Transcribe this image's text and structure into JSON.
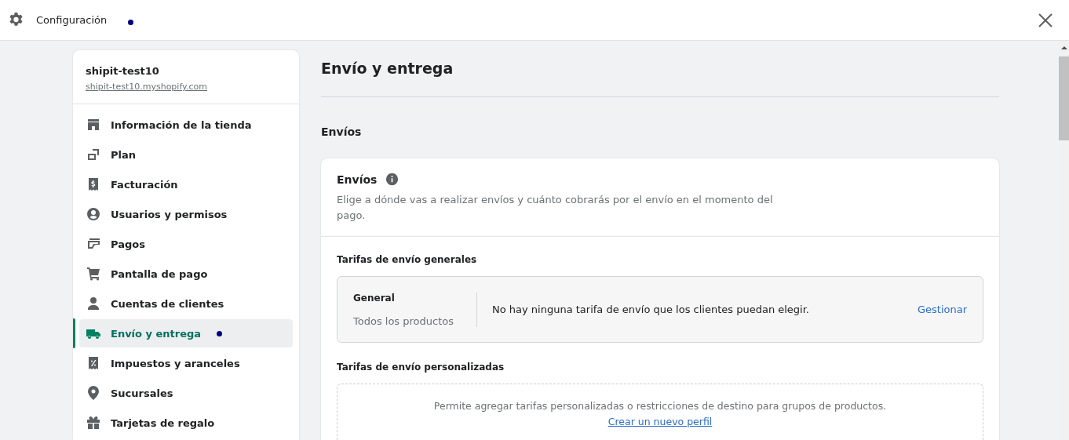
{
  "header": {
    "title": "Configuración",
    "marked": true
  },
  "store": {
    "name": "shipit-test10",
    "url": "shipit-test10.myshopify.com"
  },
  "nav": [
    {
      "label": "Información de la tienda",
      "selected": false,
      "marked": false
    },
    {
      "label": "Plan",
      "selected": false,
      "marked": false
    },
    {
      "label": "Facturación",
      "selected": false,
      "marked": false
    },
    {
      "label": "Usuarios y permisos",
      "selected": false,
      "marked": false
    },
    {
      "label": "Pagos",
      "selected": false,
      "marked": false
    },
    {
      "label": "Pantalla de pago",
      "selected": false,
      "marked": false
    },
    {
      "label": "Cuentas de clientes",
      "selected": false,
      "marked": false
    },
    {
      "label": "Envío y entrega",
      "selected": true,
      "marked": true
    },
    {
      "label": "Impuestos y aranceles",
      "selected": false,
      "marked": false
    },
    {
      "label": "Sucursales",
      "selected": false,
      "marked": false
    },
    {
      "label": "Tarjetas de regalo",
      "selected": false,
      "marked": false
    }
  ],
  "page": {
    "title": "Envío y entrega",
    "section": "Envíos"
  },
  "card": {
    "title": "Envíos",
    "description": "Elige a dónde vas a realizar envíos y cuánto cobrarás por el envío en el momento del pago.",
    "general": {
      "heading": "Tarifas de envío generales",
      "name": "General",
      "scope": "Todos los productos",
      "message": "No hay ninguna tarifa de envío que los clientes puedan elegir.",
      "action": "Gestionar"
    },
    "custom": {
      "heading": "Tarifas de envío personalizadas",
      "message": "Permite agregar tarifas personalizadas o restricciones de destino para grupos de productos.",
      "link": "Crear un nuevo perfil"
    }
  }
}
